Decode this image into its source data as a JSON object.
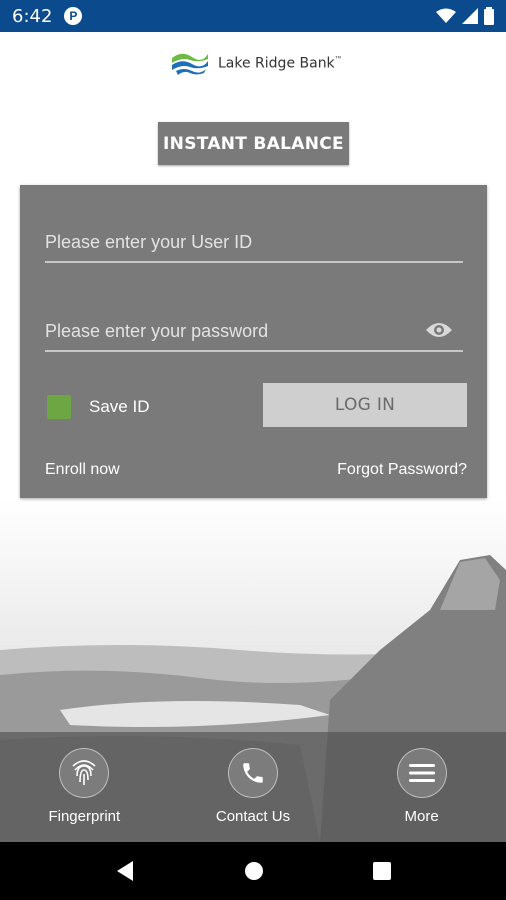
{
  "status_bar": {
    "time": "6:42",
    "app_badge": "P"
  },
  "brand": {
    "name": "Lake Ridge Bank",
    "tm": "™"
  },
  "instant_balance": {
    "label": "INSTANT BALANCE"
  },
  "login": {
    "user_id_placeholder": "Please enter your User ID",
    "password_placeholder": "Please enter your password",
    "save_id_label": "Save ID",
    "save_id_checked": true,
    "login_label": "LOG IN",
    "enroll_label": "Enroll now",
    "forgot_label": "Forgot Password?"
  },
  "bottom_nav": {
    "items": [
      {
        "label": "Fingerprint",
        "icon": "fingerprint-icon"
      },
      {
        "label": "Contact Us",
        "icon": "phone-icon"
      },
      {
        "label": "More",
        "icon": "menu-icon"
      }
    ]
  },
  "colors": {
    "status_bar": "#0b4a8c",
    "card": "#7a7a7a",
    "checkbox": "#6da643",
    "logo_blue": "#1e6fb8",
    "logo_green": "#6dbb45"
  }
}
